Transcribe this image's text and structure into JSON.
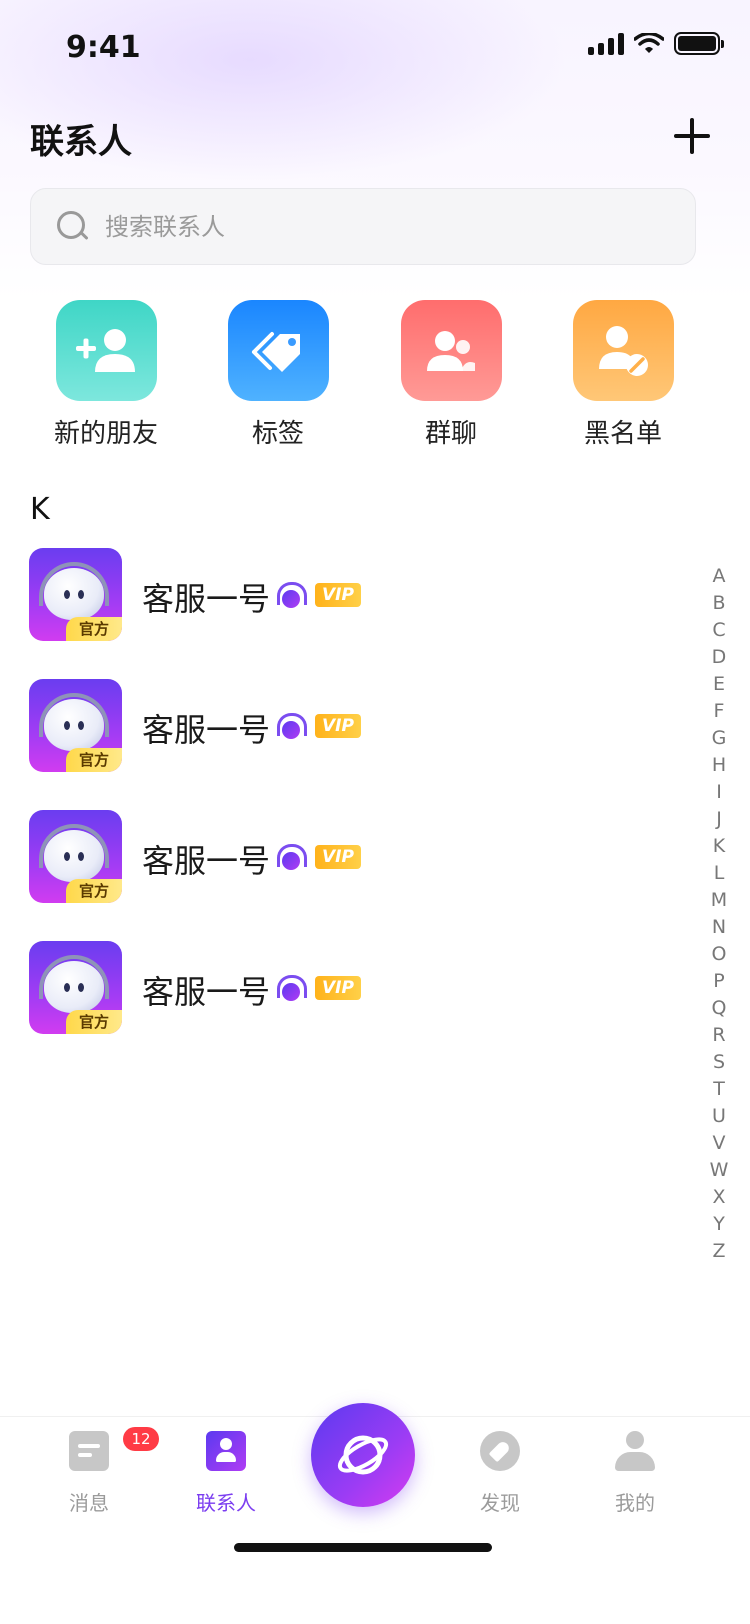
{
  "status_bar": {
    "time": "9:41"
  },
  "header": {
    "title": "联系人"
  },
  "search": {
    "placeholder": "搜索联系人"
  },
  "quick_actions": [
    {
      "label": "新的朋友",
      "icon": "add-user-icon",
      "color": "#3fd6c6"
    },
    {
      "label": "标签",
      "icon": "tag-icon",
      "color": "#1a86ff"
    },
    {
      "label": "群聊",
      "icon": "group-icon",
      "color": "#ff6d6d"
    },
    {
      "label": "黑名单",
      "icon": "blocked-user-icon",
      "color": "#ffa842"
    }
  ],
  "section": {
    "letter": "K"
  },
  "contacts": [
    {
      "name": "客服一号",
      "badge": "官方",
      "vip": "VIP"
    },
    {
      "name": "客服一号",
      "badge": "官方",
      "vip": "VIP"
    },
    {
      "name": "客服一号",
      "badge": "官方",
      "vip": "VIP"
    },
    {
      "name": "客服一号",
      "badge": "官方",
      "vip": "VIP"
    }
  ],
  "alphabet": [
    "A",
    "B",
    "C",
    "D",
    "E",
    "F",
    "G",
    "H",
    "I",
    "J",
    "K",
    "L",
    "M",
    "N",
    "O",
    "P",
    "Q",
    "R",
    "S",
    "T",
    "U",
    "V",
    "W",
    "X",
    "Y",
    "Z"
  ],
  "tab_bar": {
    "items": [
      {
        "label": "消息",
        "icon": "message-icon",
        "badge": "12"
      },
      {
        "label": "联系人",
        "icon": "contacts-icon",
        "active": true
      },
      {
        "label": "发现",
        "icon": "compass-icon"
      },
      {
        "label": "我的",
        "icon": "profile-icon"
      }
    ],
    "center_icon": "planet-icon"
  },
  "colors": {
    "accent": "#7b3df0",
    "vip": "#ffb21a",
    "badge_red": "#ff3b45"
  }
}
